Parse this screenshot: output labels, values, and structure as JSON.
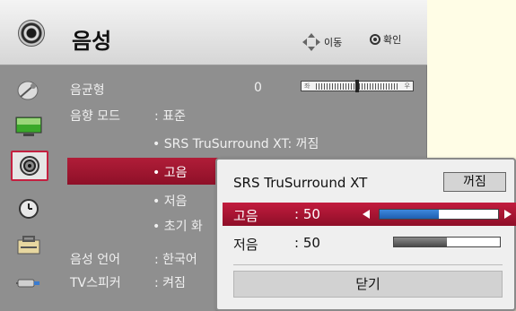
{
  "header": {
    "title": "음성",
    "nav_hint": "이동",
    "ok_hint": "확인",
    "nav_icon": "arrow-pad-icon",
    "ok_icon": "ok-button-icon"
  },
  "sidebar": {
    "items": [
      {
        "icon": "satellite-dish-icon"
      },
      {
        "icon": "display-screen-icon"
      },
      {
        "icon": "speaker-icon"
      },
      {
        "icon": "clock-icon"
      },
      {
        "icon": "lock-box-icon"
      },
      {
        "icon": "input-plug-icon"
      }
    ]
  },
  "menu": {
    "balance_label": "음균형",
    "balance_value": "0",
    "balance_bar_left": "좌",
    "balance_bar_right": "우",
    "balance_level": 0.5,
    "sound_mode_label": "음향 모드",
    "sound_mode_value": ": 표준",
    "srs_line": "• SRS TruSurround XT: 꺼짐",
    "treble_line": "• 고음",
    "bass_line": "• 저음",
    "reset_line": "• 초기 화",
    "language_label": "음성 언어",
    "language_value": ": 한국어",
    "tv_speaker_label": "TV스피커",
    "tv_speaker_value": ": 켜짐"
  },
  "popup": {
    "srs_label": "SRS TruSurround XT",
    "srs_value": "꺼짐",
    "treble_label": "고음",
    "treble_value": ":  50",
    "treble_level": 0.5,
    "bass_label": "저음",
    "bass_value": ":  50",
    "bass_level": 0.5,
    "close_label": "닫기"
  },
  "colors": {
    "highlight": "#b01d38",
    "panel_bg": "#8f8f8f",
    "slider_blue": "#1f5fb0",
    "slider_grey": "#6a6a6a"
  }
}
